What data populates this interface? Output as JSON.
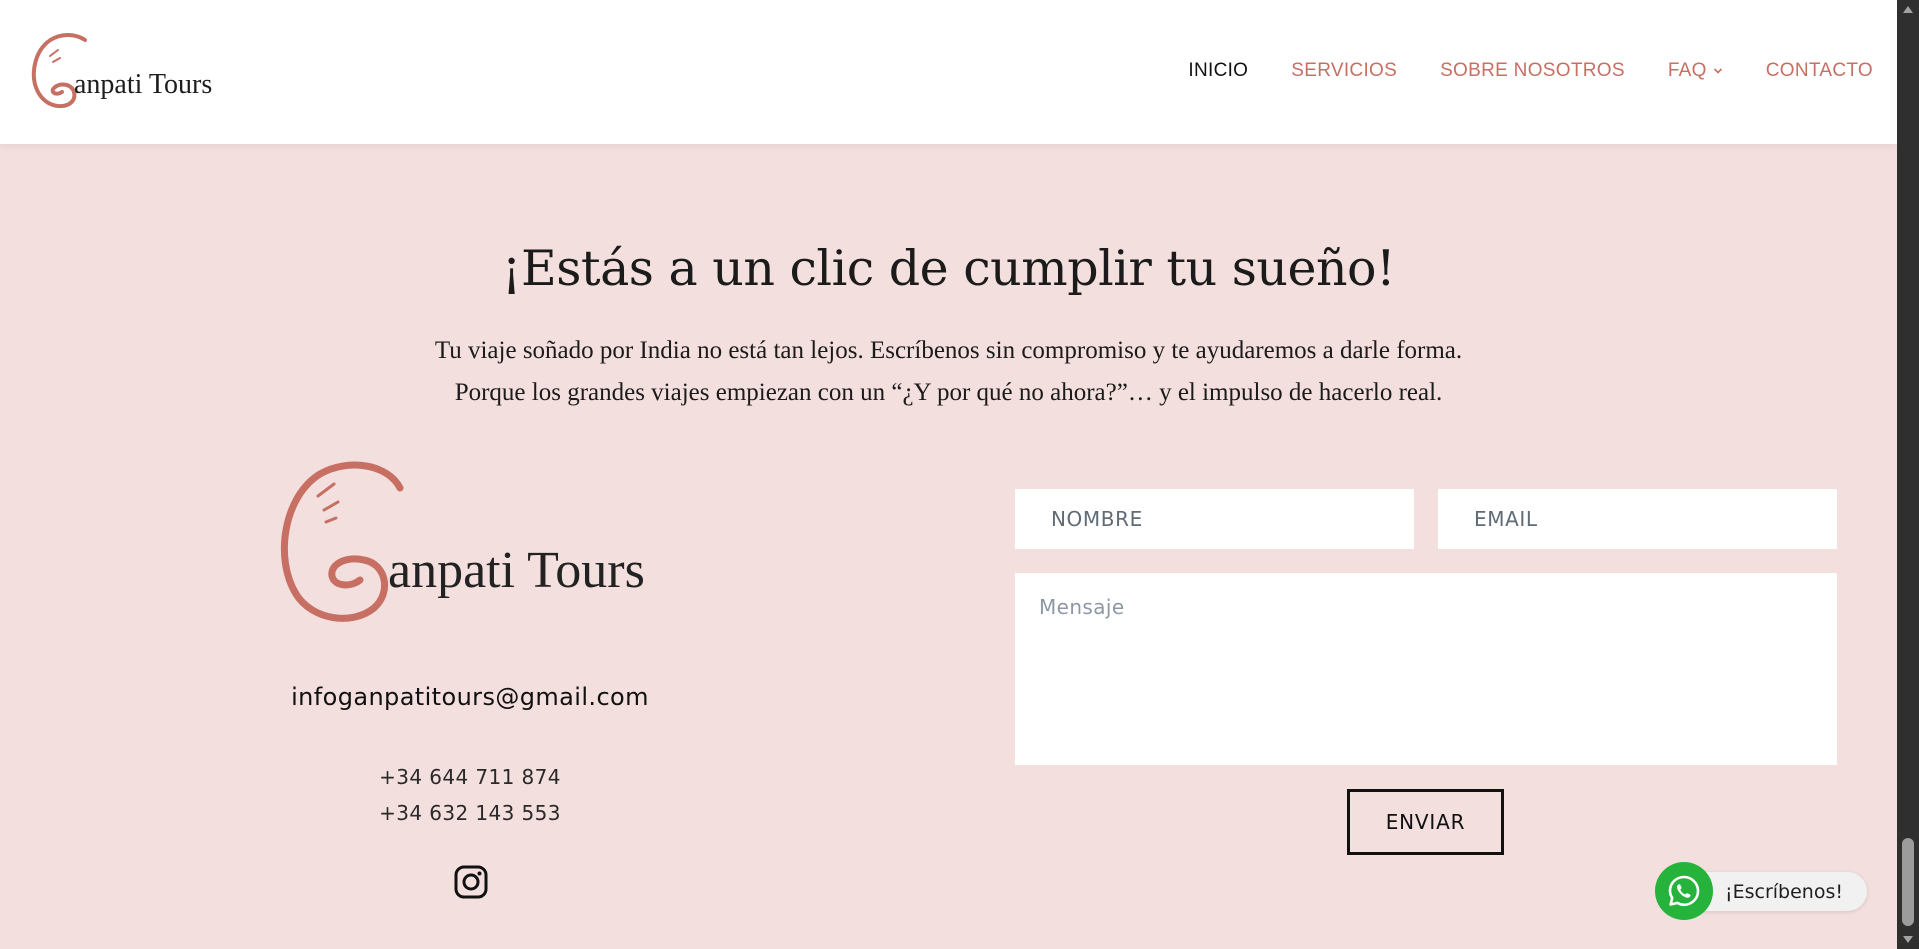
{
  "brand": {
    "name": "Ganpati Tours",
    "logo_initial": "G",
    "logo_rest": "anpati Tours",
    "accent_color": "#c76f63",
    "background_color": "#f3dfdd"
  },
  "nav": {
    "items": [
      {
        "label": "INICIO",
        "active": true
      },
      {
        "label": "SERVICIOS",
        "active": false
      },
      {
        "label": "SOBRE NOSOTROS",
        "active": false
      },
      {
        "label": "FAQ",
        "active": false,
        "has_dropdown": true
      },
      {
        "label": "CONTACTO",
        "active": false
      }
    ]
  },
  "hero": {
    "title": "¡Estás a un clic de cumplir tu sueño!",
    "subtitle_line1": "Tu viaje soñado por India no está tan lejos. Escríbenos sin compromiso y te ayudaremos a darle forma.",
    "subtitle_line2": "Porque los grandes viajes empiezan con un “¿Y por qué no ahora?”… y el impulso de hacerlo real."
  },
  "contact": {
    "email": "infoganpatitours@gmail.com",
    "phones": [
      "+34 644 711 874",
      "+34 632 143 553"
    ],
    "social_icon": "instagram-icon"
  },
  "form": {
    "name_placeholder": "NOMBRE",
    "email_placeholder": "EMAIL",
    "message_placeholder": "Mensaje",
    "submit_label": "ENVIAR"
  },
  "whatsapp": {
    "label": "¡Escríbenos!",
    "icon": "whatsapp-icon",
    "color": "#25b33c"
  }
}
